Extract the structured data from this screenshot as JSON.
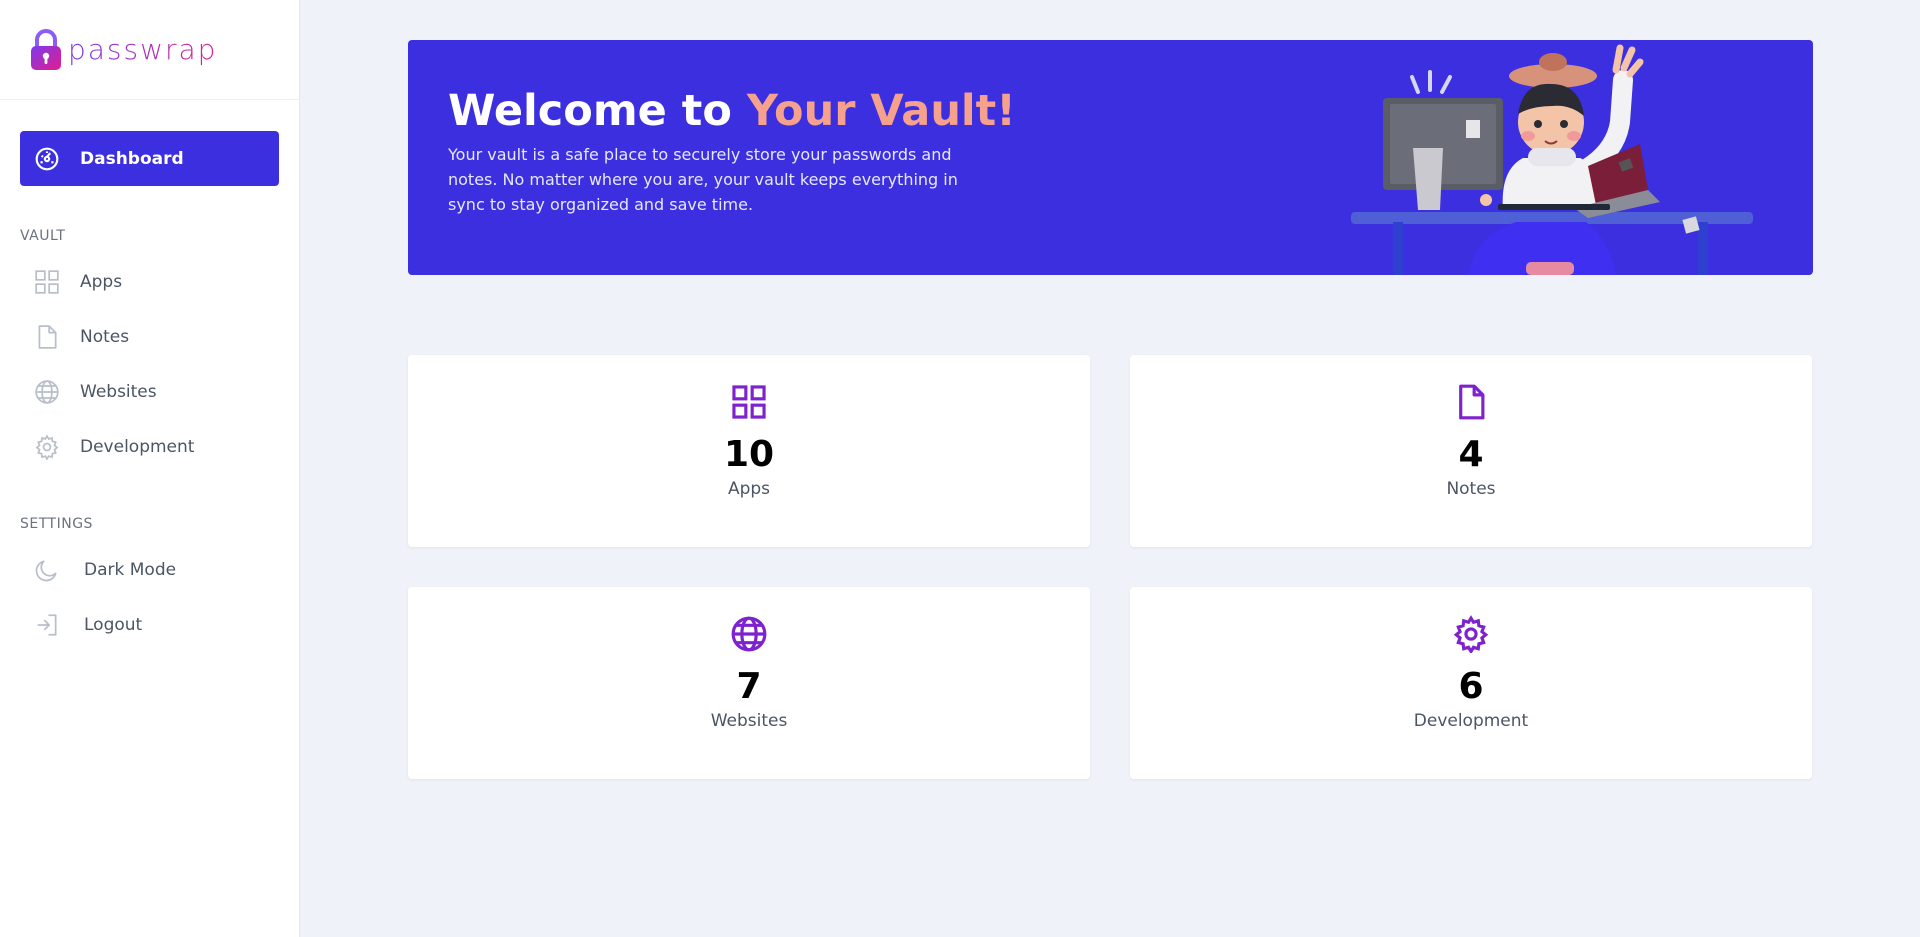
{
  "brand": {
    "name": "passwrap"
  },
  "sidebar": {
    "active_item": {
      "label": "Dashboard",
      "icon": "dashboard-icon"
    },
    "vault_section": "VAULT",
    "vault_items": [
      {
        "label": "Apps",
        "icon": "grid-icon"
      },
      {
        "label": "Notes",
        "icon": "document-icon"
      },
      {
        "label": "Websites",
        "icon": "globe-icon"
      },
      {
        "label": "Development",
        "icon": "gear-icon"
      }
    ],
    "settings_section": "SETTINGS",
    "settings_items": [
      {
        "label": "Dark Mode",
        "icon": "moon-icon"
      },
      {
        "label": "Logout",
        "icon": "logout-icon"
      }
    ]
  },
  "banner": {
    "title_prefix": "Welcome to",
    "title_accent": "Your Vault!",
    "text": "Your vault is a safe place to securely store your passwords and notes. No matter where you are, your vault keeps everything in sync to stay organized and save time."
  },
  "stats": [
    {
      "count": "10",
      "label": "Apps",
      "icon": "grid-icon"
    },
    {
      "count": "4",
      "label": "Notes",
      "icon": "document-icon"
    },
    {
      "count": "7",
      "label": "Websites",
      "icon": "globe-icon"
    },
    {
      "count": "6",
      "label": "Development",
      "icon": "gear-icon"
    }
  ],
  "colors": {
    "primary": "#3b2fe0",
    "accent": "#f6a08e",
    "icon_purple": "#7e22ce",
    "background": "#f0f2fa"
  }
}
